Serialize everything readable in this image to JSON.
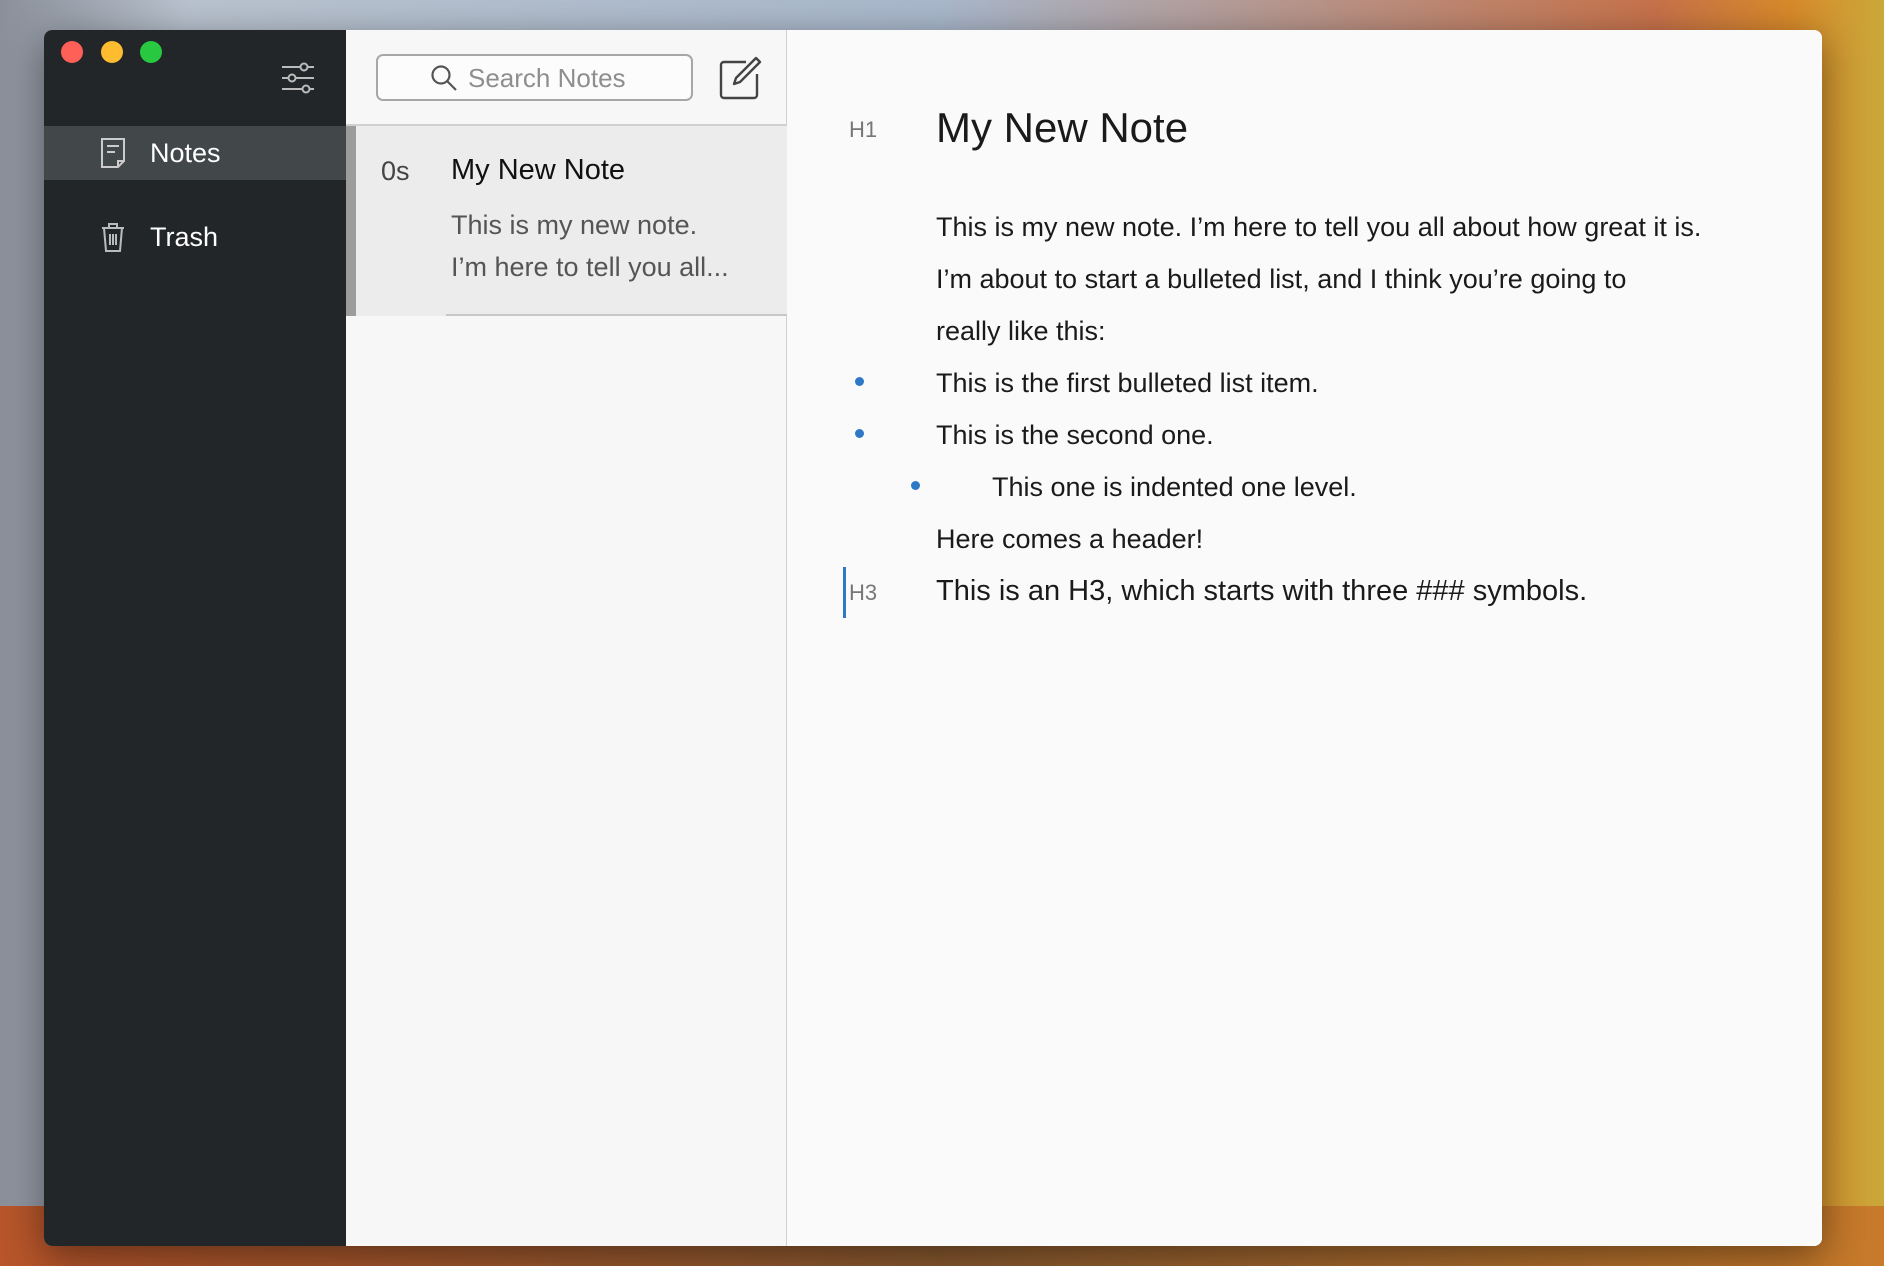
{
  "window": {
    "traffic_lights": {
      "close": "#fe5f57",
      "minimize": "#febc2e",
      "zoom": "#28c840"
    }
  },
  "sidebar": {
    "items": [
      {
        "label": "Notes",
        "icon": "note-icon",
        "active": true
      },
      {
        "label": "Trash",
        "icon": "trash-icon",
        "active": false
      }
    ],
    "filter_icon": "sliders-icon"
  },
  "list": {
    "search_placeholder": "Search Notes",
    "compose_icon": "compose-icon",
    "notes": [
      {
        "age": "0s",
        "title": "My New Note",
        "preview_line1": "This is my new note.",
        "preview_line2": "I’m here to tell you all..."
      }
    ]
  },
  "editor": {
    "h1_marker": "H1",
    "title": "My New Note",
    "paragraph_lines": [
      "This is my new note. I’m here to tell you all about how great it is.",
      "I’m about to start a bulleted list, and I think you’re going to",
      "really like this:"
    ],
    "bullets": [
      "This is the first bulleted list item.",
      "This is the second one."
    ],
    "sub_bullets": [
      "This one is indented one level."
    ],
    "pre_header": "Here comes a header!",
    "h3_marker": "H3",
    "h3": "This is an H3, which starts with three ### symbols.",
    "accent": "#2e78c8"
  }
}
